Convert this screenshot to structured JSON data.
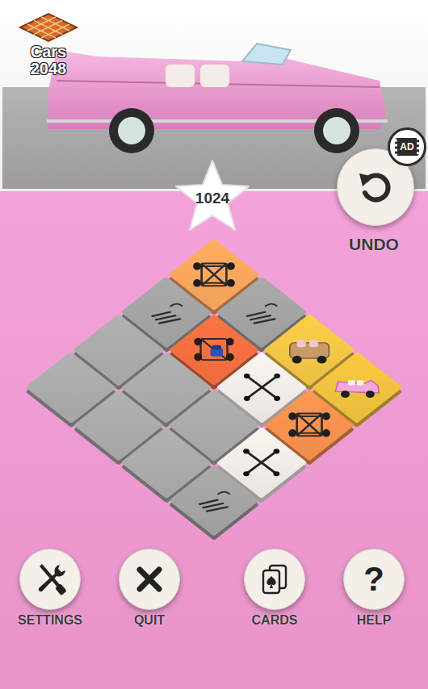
{
  "banner": {
    "logo": {
      "title": "Cars",
      "number": "2048"
    }
  },
  "score": {
    "value": "1024"
  },
  "undo": {
    "label": "UNDO",
    "badge": "AD"
  },
  "board": {
    "rows": [
      [
        {
          "kind": "chassis",
          "color": "#f2a15a"
        },
        {
          "kind": "parts",
          "color": "#9e9e9e"
        },
        {
          "kind": "wood",
          "color": "#eac043"
        },
        {
          "kind": "cadillac",
          "color": "#e9bb3c"
        }
      ],
      [
        {
          "kind": "parts",
          "color": "#9e9e9e"
        },
        {
          "kind": "kart",
          "color": "#ec6b3d"
        },
        {
          "kind": "axle",
          "color": "#e8e4e0"
        },
        {
          "kind": "chassis",
          "color": "#f08d4c"
        }
      ],
      [
        {
          "kind": "empty",
          "color": "#a5a5a5"
        },
        {
          "kind": "empty",
          "color": "#a5a5a5"
        },
        {
          "kind": "empty",
          "color": "#a5a5a5"
        },
        {
          "kind": "axle",
          "color": "#e8e4e0"
        }
      ],
      [
        {
          "kind": "empty",
          "color": "#a5a5a5"
        },
        {
          "kind": "empty",
          "color": "#a5a5a5"
        },
        {
          "kind": "empty",
          "color": "#a5a5a5"
        },
        {
          "kind": "parts",
          "color": "#9e9e9e"
        }
      ]
    ]
  },
  "toolbar": [
    {
      "label": "SETTINGS",
      "kind": "settings"
    },
    {
      "label": "QUIT",
      "kind": "quit"
    },
    {
      "label": "CARDS",
      "kind": "cards"
    },
    {
      "label": "HELP",
      "kind": "help",
      "glyph": "?"
    }
  ]
}
